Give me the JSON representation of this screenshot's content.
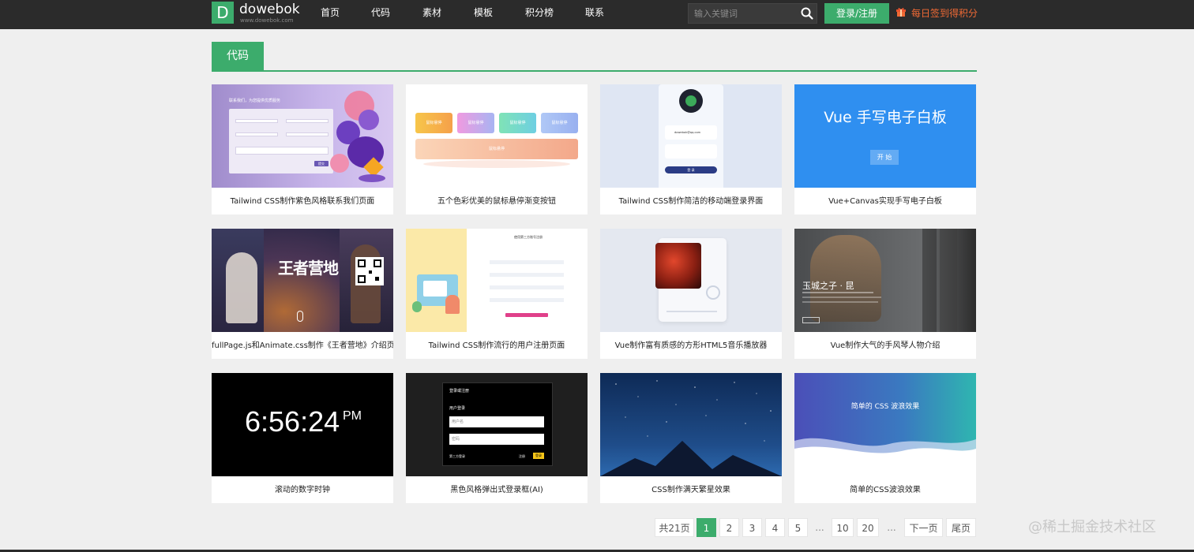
{
  "brand": {
    "logo_letter": "D",
    "name": "dowebok",
    "url": "www.dowebok.com",
    "accent": "#3cac6c"
  },
  "nav": {
    "items": [
      "首页",
      "代码",
      "素材",
      "模板",
      "积分榜",
      "联系"
    ]
  },
  "search": {
    "placeholder": "输入关键词"
  },
  "header": {
    "login_label": "登录/注册",
    "signin_label": "每日签到得积分"
  },
  "section": {
    "tab_label": "代码"
  },
  "cards": [
    {
      "title": "Tailwind CSS制作紫色风格联系我们页面",
      "thumb": {
        "heading": "联系我们，为您提供优质服务",
        "button": "提交"
      }
    },
    {
      "title": "五个色彩优美的鼠标悬停渐变按钮",
      "thumb": {
        "buttons": [
          "鼠标悬停",
          "鼠标悬停",
          "鼠标悬停",
          "鼠标悬停"
        ],
        "wide_button": "鼠标悬停"
      }
    },
    {
      "title": "Tailwind CSS制作简洁的移动端登录界面",
      "thumb": {
        "email": "dowebok@qq.com",
        "button": "登 录"
      }
    },
    {
      "title": "Vue+Canvas实现手写电子白板",
      "thumb": {
        "heading": "Vue 手写电子白板",
        "button": "开 始"
      }
    },
    {
      "title": "fullPage.js和Animate.css制作《王者营地》介绍页",
      "thumb": {
        "heading": "王者营地"
      }
    },
    {
      "title": "Tailwind CSS制作流行的用户注册页面",
      "thumb": {
        "heading": "使用第三方账号注册"
      }
    },
    {
      "title": "Vue制作富有质感的方形HTML5音乐播放器",
      "thumb": {}
    },
    {
      "title": "Vue制作大气的手风琴人物介绍",
      "thumb": {
        "heading": "玉城之子 · 昆"
      }
    },
    {
      "title": "滚动的数字时钟",
      "thumb": {
        "time": "6:56:24",
        "ampm": "PM"
      }
    },
    {
      "title": "黑色风格弹出式登录框(AI)",
      "thumb": {
        "heading": "登录或注册",
        "label": "用户登录",
        "username_placeholder": "用户名",
        "password_placeholder": "密码",
        "third_party": "第三方登录",
        "register": "注册",
        "login": "登录"
      }
    },
    {
      "title": "CSS制作满天繁星效果",
      "thumb": {}
    },
    {
      "title": "简单的CSS波浪效果",
      "thumb": {
        "heading": "简单的 CSS 波浪效果"
      }
    }
  ],
  "pagination": {
    "total": "共21页",
    "pages": [
      "1",
      "2",
      "3",
      "4",
      "5",
      "...",
      "10",
      "20",
      "..."
    ],
    "current": "1",
    "next": "下一页",
    "last": "尾页"
  },
  "watermark": "@稀土掘金技术社区"
}
